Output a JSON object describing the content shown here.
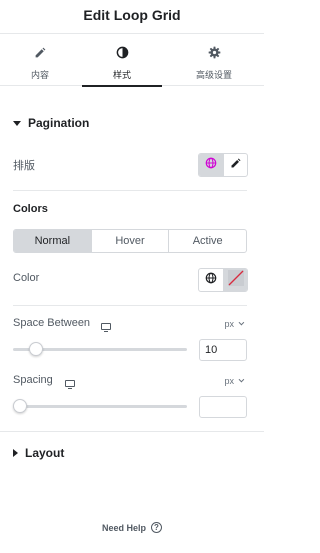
{
  "header": {
    "title": "Edit Loop Grid"
  },
  "tabs": [
    {
      "label": "内容",
      "icon": "pencil-icon"
    },
    {
      "label": "样式",
      "icon": "half-circle-icon",
      "active": true
    },
    {
      "label": "高级设置",
      "icon": "gear-icon"
    }
  ],
  "pagination": {
    "section_title": "Pagination",
    "layout_label": "排版",
    "colors_heading": "Colors",
    "states": [
      "Normal",
      "Hover",
      "Active"
    ],
    "active_state": "Normal",
    "color_label": "Color",
    "space_between": {
      "label": "Space Between",
      "unit": "px",
      "value": "10",
      "slider_fraction": 0.1
    },
    "spacing": {
      "label": "Spacing",
      "unit": "px",
      "value": "",
      "slider_fraction": 0.0
    }
  },
  "layout_section": {
    "title": "Layout"
  },
  "footer": {
    "help_label": "Need Help",
    "help_icon_glyph": "?"
  },
  "colors": {
    "accent_global": "#d004d4",
    "clear_red": "#d72b3f",
    "active_bg": "#d5d8dc"
  }
}
